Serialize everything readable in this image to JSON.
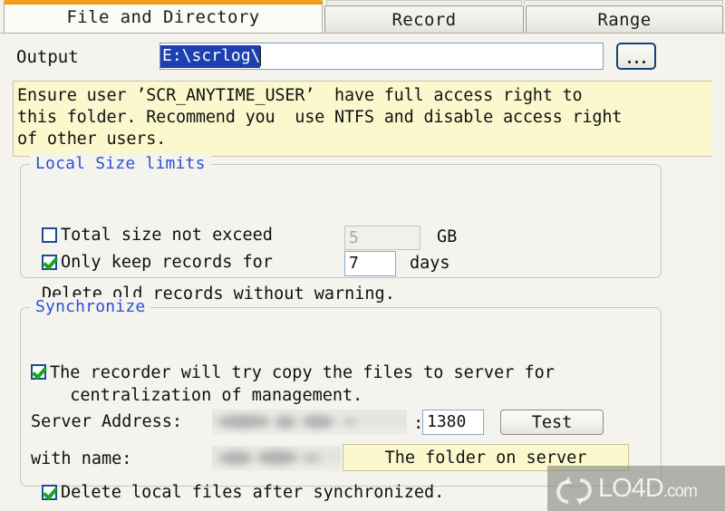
{
  "tabs": [
    {
      "id": "file",
      "label": "File and Directory",
      "active": true
    },
    {
      "id": "record",
      "label": "Record",
      "active": false
    },
    {
      "id": "range",
      "label": "Range",
      "active": false
    }
  ],
  "output": {
    "label": "Output",
    "value": "E:\\scrlog\\",
    "placeholder": "",
    "browse_label": "...",
    "browse_icon": "ellipsis-icon"
  },
  "notice": {
    "text": "Ensure user ’SCR_ANYTIME_USER’  have full access right to\nthis folder. Recommend you  use NTFS and disable access right\nof other users."
  },
  "size_limits": {
    "title": "Local Size limits",
    "total_size": {
      "label": "Total size not exceed",
      "checked": false,
      "value": "5",
      "unit": "GB"
    },
    "keep_records": {
      "label": "Only keep records for",
      "checked": true,
      "value": "7",
      "unit": "days"
    },
    "footnote": "Delete old records without warning."
  },
  "synchronize": {
    "title": "Synchronize",
    "enable": {
      "label": "The recorder will try copy the files to server for\n  centralization of management.",
      "checked": true
    },
    "server_address": {
      "label": "Server Address:",
      "value": "",
      "redacted": true,
      "colon": ":",
      "port": "1380",
      "test_label": "Test"
    },
    "with_name": {
      "label": "with name:",
      "value": "",
      "redacted": true,
      "note": "The folder on server"
    },
    "delete_local": {
      "label": "Delete local files after synchronized.",
      "checked": true
    }
  },
  "watermark": {
    "main": "LO4D",
    "suffix": ".com",
    "icon": "refresh-circular-arrows-icon"
  },
  "colors": {
    "tab_accent": "#f0a01e",
    "group_title": "#2a4fd6",
    "notice_bg": "#fbf8cd",
    "selection_bg": "#1d3fb0",
    "check_green": "#17a81a",
    "checkbox_border": "#1d4d8f"
  }
}
